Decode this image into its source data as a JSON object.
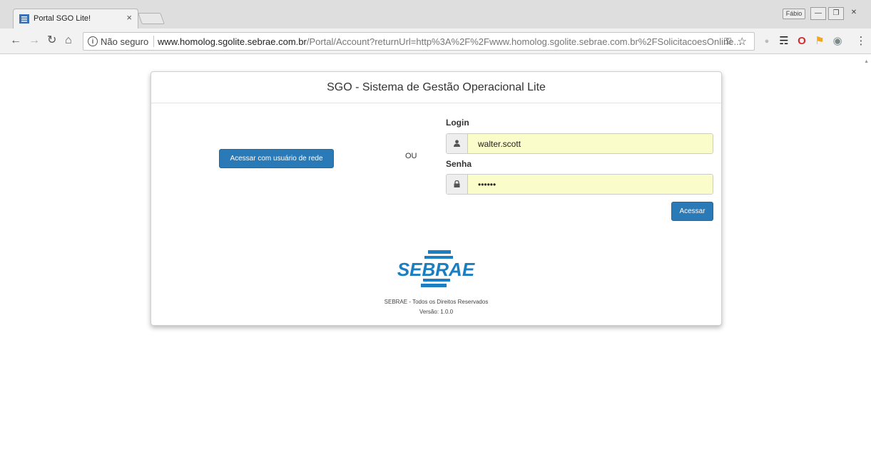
{
  "browser": {
    "tab_title": "Portal SGO Lite!",
    "tab_close": "×",
    "user_badge": "Fábio",
    "security_label": "Não seguro",
    "url_host": "www.homolog.sgolite.sebrae.com.br",
    "url_rest": "/Portal/Account?returnUrl=http%3A%2F%2Fwww.homolog.sgolite.sebrae.com.br%2FSolicitacoesOnline..."
  },
  "page": {
    "heading": "SGO - Sistema de Gestão Operacional Lite",
    "network_button_label": "Acessar com usuário de rede",
    "or_label": "OU",
    "login_label": "Login",
    "login_value": "walter.scott",
    "password_label": "Senha",
    "password_value": "••••••",
    "submit_label": "Acessar",
    "logo_text": "SEBRAE",
    "footer_rights": "SEBRAE - Todos os Direitos Reservados",
    "footer_version": "Versão: 1.0.0"
  },
  "colors": {
    "primary_button": "#2a7ab8",
    "autofill_background": "#fafdca",
    "sebrae_blue": "#1a7ec1"
  },
  "icons": {
    "login_addon": "user-icon",
    "password_addon": "lock-icon"
  }
}
